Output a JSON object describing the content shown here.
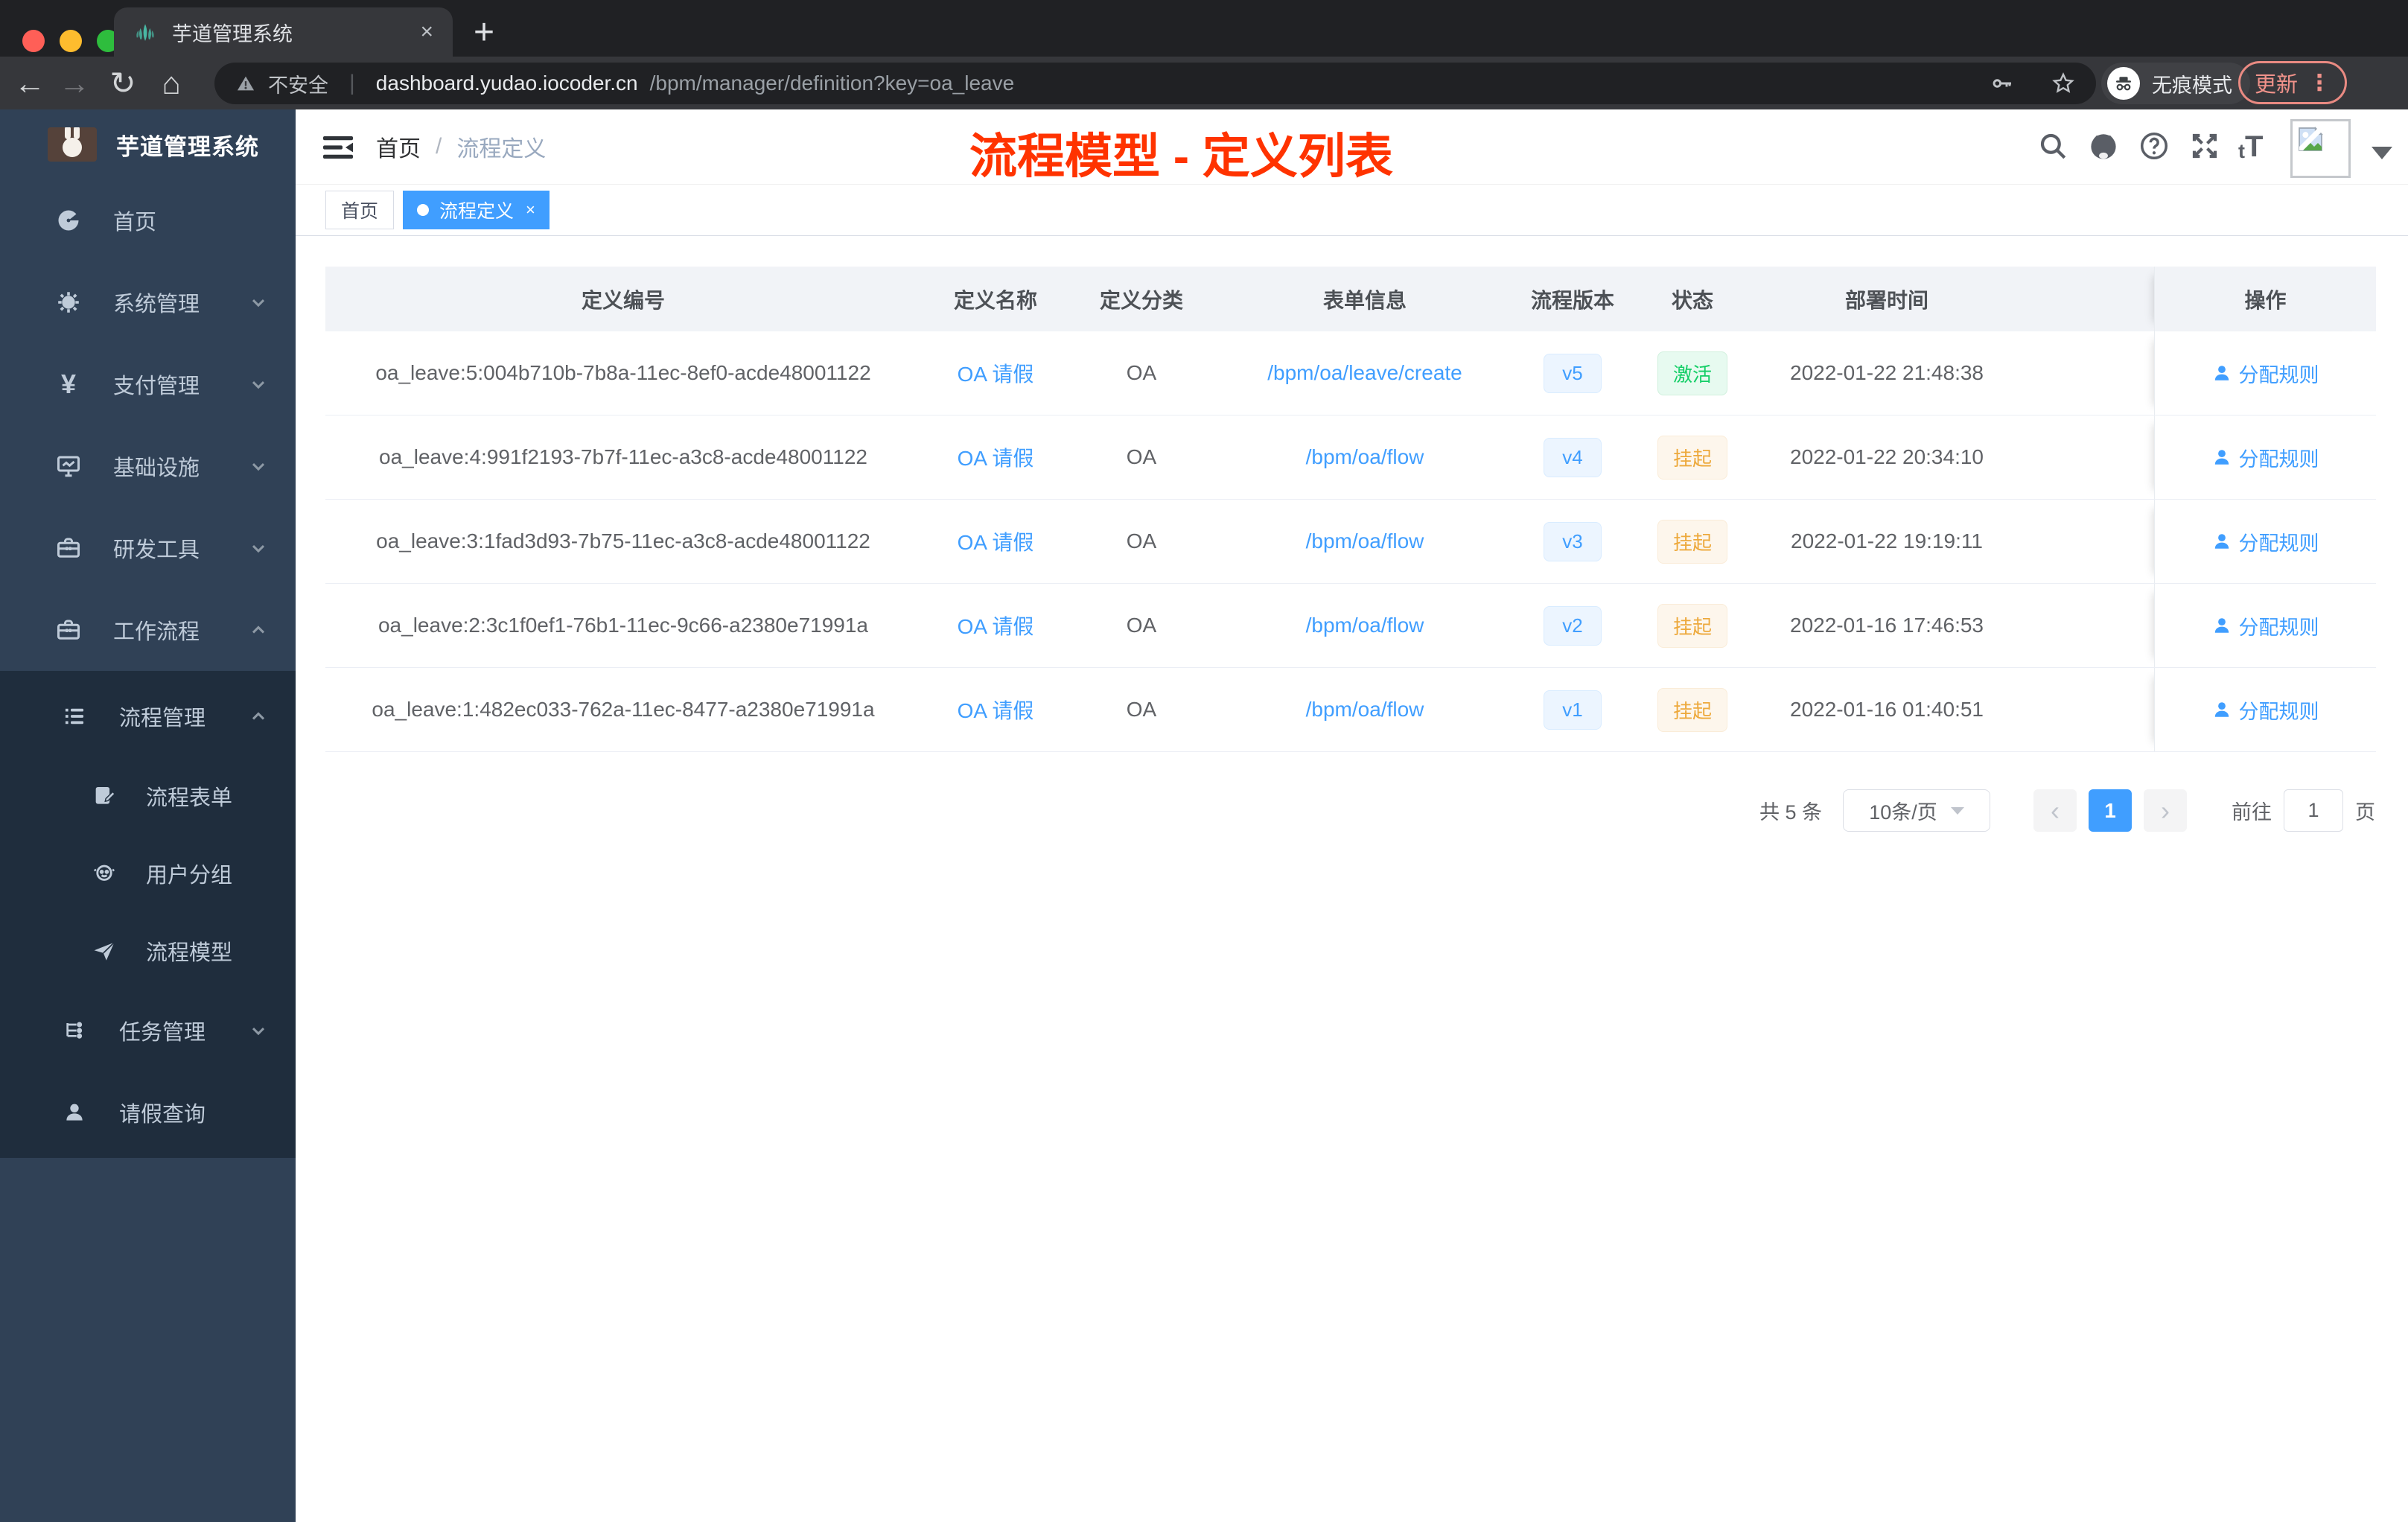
{
  "browser": {
    "tab_title": "芋道管理系统",
    "close_tab": "×",
    "new_tab": "+",
    "back": "←",
    "forward": "→",
    "reload": "↻",
    "home": "⌂",
    "security_label": "不安全",
    "divider": "|",
    "url_host": "dashboard.yudao.iocoder.cn",
    "url_path": "/bpm/manager/definition?key=oa_leave",
    "incognito_label": "无痕模式",
    "update_label": "更新",
    "menu_dots": "⋮"
  },
  "sidebar": {
    "logo_title": "芋道管理系统",
    "items": [
      {
        "label": "首页",
        "icon": "dashboard-icon"
      },
      {
        "label": "系统管理",
        "icon": "gear-icon"
      },
      {
        "label": "支付管理",
        "icon": "yen-icon",
        "glyph": "¥"
      },
      {
        "label": "基础设施",
        "icon": "monitor-icon"
      },
      {
        "label": "研发工具",
        "icon": "toolbox-icon"
      },
      {
        "label": "工作流程",
        "icon": "briefcase-icon"
      }
    ],
    "submenu": {
      "group_label": "流程管理",
      "children": [
        {
          "label": "流程表单",
          "icon": "form-icon"
        },
        {
          "label": "用户分组",
          "icon": "user-group-icon"
        },
        {
          "label": "流程模型",
          "icon": "paper-plane-icon"
        }
      ],
      "task_label": "任务管理",
      "leave_label": "请假查询"
    }
  },
  "navbar": {
    "breadcrumb_home": "首页",
    "breadcrumb_sep": "/",
    "breadcrumb_current": "流程定义",
    "font_icon_small": "t",
    "font_icon_big": "T"
  },
  "annotation": {
    "text": "流程模型 - 定义列表",
    "color": "#ff3300"
  },
  "tags": {
    "home": "首页",
    "active": "流程定义",
    "close": "×"
  },
  "table": {
    "columns": [
      "定义编号",
      "定义名称",
      "定义分类",
      "表单信息",
      "流程版本",
      "状态",
      "部署时间",
      "操作"
    ],
    "rows": [
      {
        "id": "oa_leave:5:004b710b-7b8a-11ec-8ef0-acde48001122",
        "name": "OA 请假",
        "category": "OA",
        "form": "/bpm/oa/leave/create",
        "version": "v5",
        "status": "激活",
        "deployed": "2022-01-22 21:48:38",
        "action": "分配规则"
      },
      {
        "id": "oa_leave:4:991f2193-7b7f-11ec-a3c8-acde48001122",
        "name": "OA 请假",
        "category": "OA",
        "form": "/bpm/oa/flow",
        "version": "v4",
        "status": "挂起",
        "deployed": "2022-01-22 20:34:10",
        "action": "分配规则"
      },
      {
        "id": "oa_leave:3:1fad3d93-7b75-11ec-a3c8-acde48001122",
        "name": "OA 请假",
        "category": "OA",
        "form": "/bpm/oa/flow",
        "version": "v3",
        "status": "挂起",
        "deployed": "2022-01-22 19:19:11",
        "action": "分配规则"
      },
      {
        "id": "oa_leave:2:3c1f0ef1-76b1-11ec-9c66-a2380e71991a",
        "name": "OA 请假",
        "category": "OA",
        "form": "/bpm/oa/flow",
        "version": "v2",
        "status": "挂起",
        "deployed": "2022-01-16 17:46:53",
        "action": "分配规则"
      },
      {
        "id": "oa_leave:1:482ec033-762a-11ec-8477-a2380e71991a",
        "name": "OA 请假",
        "category": "OA",
        "form": "/bpm/oa/flow",
        "version": "v1",
        "status": "挂起",
        "deployed": "2022-01-16 01:40:51",
        "action": "分配规则"
      }
    ]
  },
  "pagination": {
    "total": "共 5 条",
    "page_size": "10条/页",
    "prev": "‹",
    "page": "1",
    "next": "›",
    "goto_label": "前往",
    "goto_value": "1",
    "unit": "页"
  },
  "colors": {
    "accent": "#409eff",
    "active_green": "#13ce66",
    "suspended_yellow": "#e6a23c",
    "annotation_red": "#ff3300",
    "sidebar_bg": "#304156",
    "submenu_bg": "#1f2d3d"
  }
}
